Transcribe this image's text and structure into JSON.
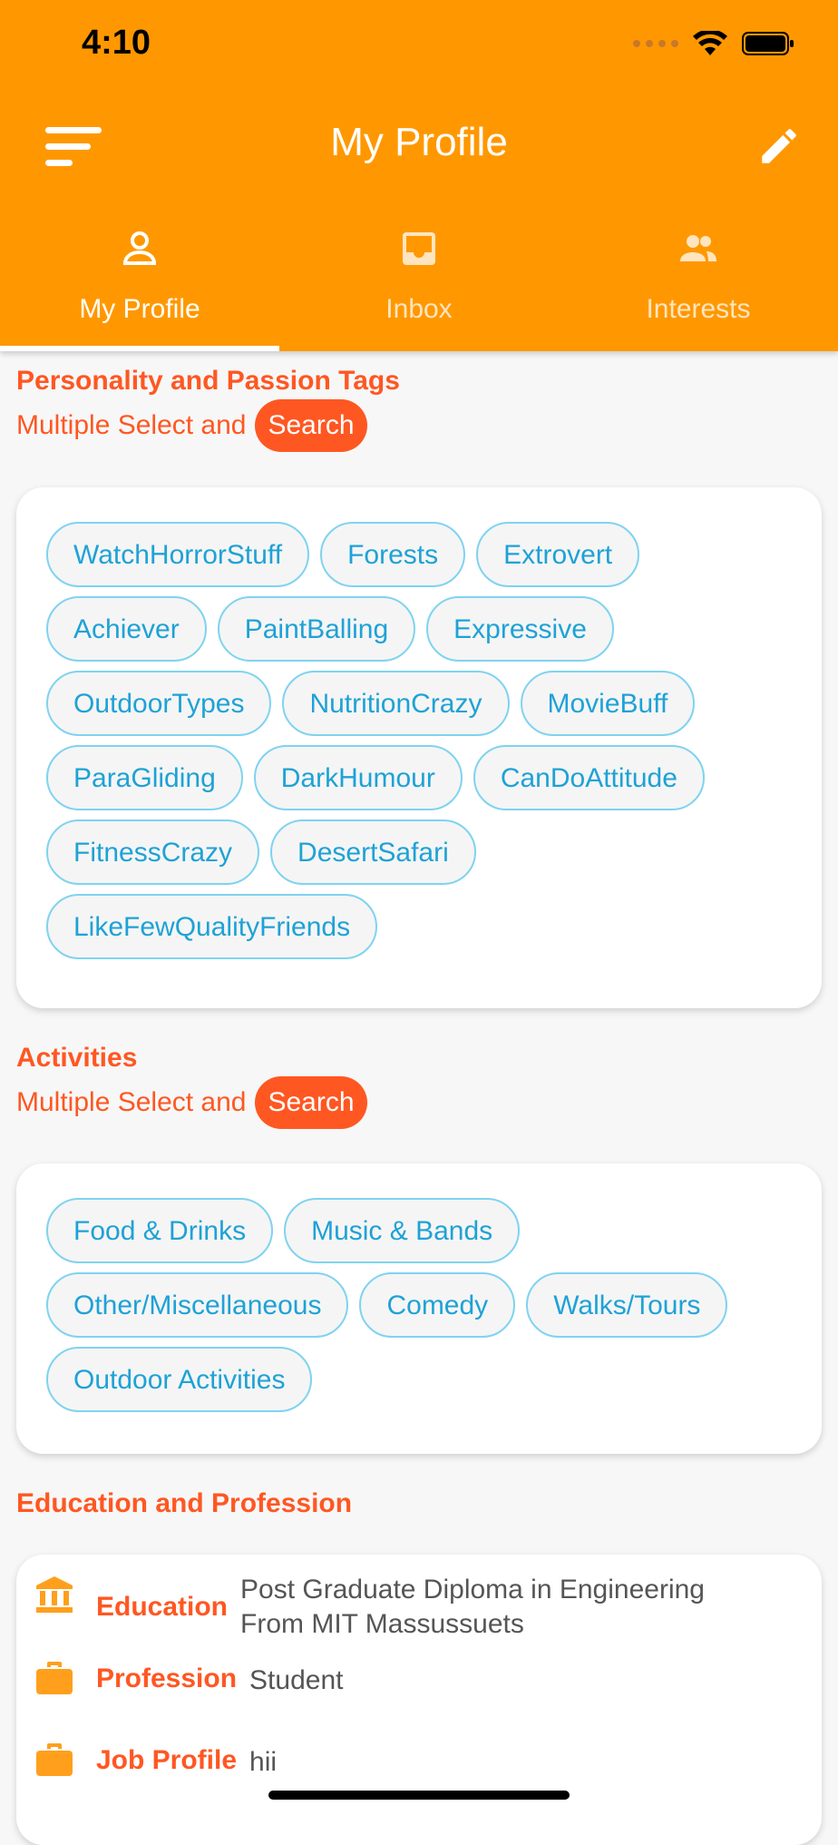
{
  "status_bar": {
    "time": "4:10"
  },
  "header": {
    "title": "My Profile"
  },
  "tabs": [
    {
      "label": "My Profile",
      "icon": "person-icon",
      "active": true
    },
    {
      "label": "Inbox",
      "icon": "inbox-icon",
      "active": false
    },
    {
      "label": "Interests",
      "icon": "group-icon",
      "active": false
    }
  ],
  "personality": {
    "title": "Personality and Passion Tags",
    "subtitle": "Multiple Select and",
    "search_label": "Search",
    "tags": [
      "WatchHorrorStuff",
      "Forests",
      "Extrovert",
      "Achiever",
      "PaintBalling",
      "Expressive",
      "OutdoorTypes",
      "NutritionCrazy",
      "MovieBuff",
      "ParaGliding",
      "DarkHumour",
      "CanDoAttitude",
      "FitnessCrazy",
      "DesertSafari",
      "LikeFewQualityFriends"
    ]
  },
  "activities": {
    "title": "Activities",
    "subtitle": "Multiple Select and",
    "search_label": "Search",
    "tags": [
      "Food & Drinks",
      "Music & Bands",
      "Other/Miscellaneous",
      "Comedy",
      "Walks/Tours",
      "Outdoor Activities"
    ]
  },
  "education_section": {
    "title": "Education and Profession",
    "rows": [
      {
        "label": "Education",
        "value": "Post Graduate Diploma in Engineering From MIT Massussuets",
        "icon": "institution-icon"
      },
      {
        "label": "Profession",
        "value": "Student",
        "icon": "briefcase-icon"
      },
      {
        "label": "Job Profile",
        "value": "hii",
        "icon": "briefcase-icon"
      }
    ]
  },
  "colors": {
    "primary": "#ff9800",
    "accent": "#ff5722",
    "chip_text": "#1ea2d6",
    "chip_border": "#7fd3f0"
  }
}
